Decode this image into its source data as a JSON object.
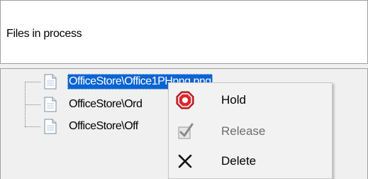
{
  "panel": {
    "title": "Files in process"
  },
  "tree": {
    "items": [
      {
        "label": "OfficeStore\\Office1PHpng.png"
      },
      {
        "label": "OfficeStore\\Ord"
      },
      {
        "label": "OfficeStore\\Off"
      }
    ],
    "selected_index": 0
  },
  "context_menu": {
    "items": [
      {
        "label": "Hold",
        "icon": "stop-sign-icon",
        "enabled": true
      },
      {
        "label": "Release",
        "icon": "release-check-icon",
        "enabled": false
      },
      {
        "label": "Delete",
        "icon": "delete-x-icon",
        "enabled": true
      }
    ]
  },
  "colors": {
    "selection": "#0a64d2",
    "stop_sign": "#d9282f",
    "disabled_text": "#6d6d6d"
  }
}
